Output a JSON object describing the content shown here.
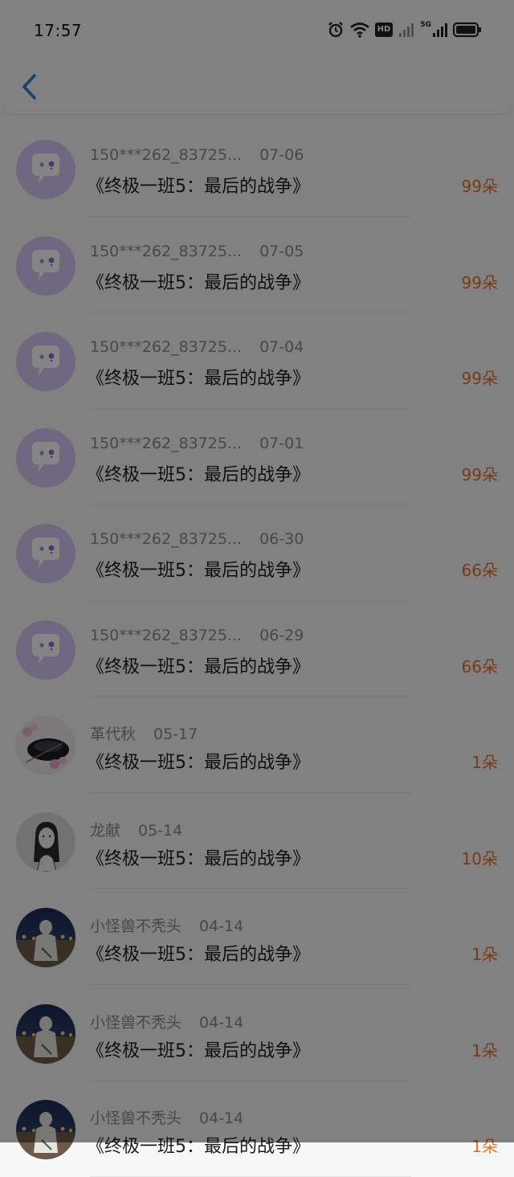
{
  "status_bar": {
    "time": "17:57",
    "icons": [
      "alarm-icon",
      "wifi-icon",
      "hd-icon",
      "signal-icon",
      "5g-signal-icon",
      "battery-icon"
    ],
    "hd_text": "HD",
    "net_text": "5G"
  },
  "nav": {
    "back_icon": "chevron-left-icon"
  },
  "colors": {
    "accent": "#e7722a",
    "back": "#2f7bd0",
    "avatar_default": "#d7c7f5",
    "overlay": "rgba(0,0,0,0.48)"
  },
  "records": [
    {
      "user": "150***262_83725...",
      "date": "07-06",
      "title": "《终极一班5：最后的战争》",
      "gift": "99朵",
      "avatar": "default-chat-avatar"
    },
    {
      "user": "150***262_83725...",
      "date": "07-05",
      "title": "《终极一班5：最后的战争》",
      "gift": "99朵",
      "avatar": "default-chat-avatar"
    },
    {
      "user": "150***262_83725...",
      "date": "07-04",
      "title": "《终极一班5：最后的战争》",
      "gift": "99朵",
      "avatar": "default-chat-avatar"
    },
    {
      "user": "150***262_83725...",
      "date": "07-01",
      "title": "《终极一班5：最后的战争》",
      "gift": "99朵",
      "avatar": "default-chat-avatar"
    },
    {
      "user": "150***262_83725...",
      "date": "06-30",
      "title": "《终极一班5：最后的战争》",
      "gift": "66朵",
      "avatar": "default-chat-avatar"
    },
    {
      "user": "150***262_83725...",
      "date": "06-29",
      "title": "《终极一班5：最后的战争》",
      "gift": "66朵",
      "avatar": "default-chat-avatar"
    },
    {
      "user": "革代秋",
      "date": "05-17",
      "title": "《终极一班5：最后的战争》",
      "gift": "1朵",
      "avatar": "photo-avatar-flowers"
    },
    {
      "user": "龙献",
      "date": "05-14",
      "title": "《终极一班5：最后的战争》",
      "gift": "10朵",
      "avatar": "photo-avatar-portrait"
    },
    {
      "user": "小怪兽不秃头",
      "date": "04-14",
      "title": "《终极一班5：最后的战争》",
      "gift": "1朵",
      "avatar": "photo-avatar-night"
    },
    {
      "user": "小怪兽不秃头",
      "date": "04-14",
      "title": "《终极一班5：最后的战争》",
      "gift": "1朵",
      "avatar": "photo-avatar-night"
    },
    {
      "user": "小怪兽不秃头",
      "date": "04-14",
      "title": "《终极一班5：最后的战争》",
      "gift": "1朵",
      "avatar": "photo-avatar-night"
    }
  ]
}
